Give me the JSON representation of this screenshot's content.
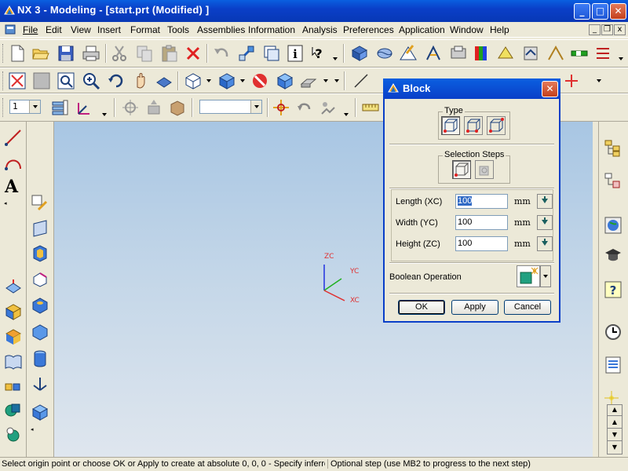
{
  "window": {
    "title": "NX 3 - Modeling - [start.prt (Modified) ]",
    "controls": {
      "minimize": "_",
      "maximize": "□",
      "close": "✕"
    }
  },
  "menubar": {
    "items": [
      {
        "label": "File"
      },
      {
        "label": "Edit"
      },
      {
        "label": "View"
      },
      {
        "label": "Insert"
      },
      {
        "label": "Format"
      },
      {
        "label": "Tools"
      },
      {
        "label": "Assemblies"
      },
      {
        "label": "Information"
      },
      {
        "label": "Analysis"
      },
      {
        "label": "Preferences"
      },
      {
        "label": "Application"
      },
      {
        "label": "Window"
      },
      {
        "label": "Help"
      }
    ],
    "mdi": {
      "minimize": "_",
      "restore": "❐",
      "close": "x"
    }
  },
  "toolbar3": {
    "layer_combo_value": "1",
    "filter_combo_value": ""
  },
  "left_dock": {
    "text_tool_glyph": "A"
  },
  "viewport": {
    "axes": {
      "z_label": "ZC",
      "y_label": "YC",
      "x_label": "XC"
    }
  },
  "dialog": {
    "title": "Block",
    "close_glyph": "✕",
    "type_group_label": "Type",
    "selection_steps_label": "Selection Steps",
    "fields": [
      {
        "label": "Length (XC)",
        "value": "100",
        "unit": "mm"
      },
      {
        "label": "Width (YC)",
        "value": "100",
        "unit": "mm"
      },
      {
        "label": "Height (ZC)",
        "value": "100",
        "unit": "mm"
      }
    ],
    "boolean_label": "Boolean Operation",
    "buttons": {
      "ok": "OK",
      "apply": "Apply",
      "cancel": "Cancel"
    }
  },
  "statusbar": {
    "prompt": "Select origin point or choose OK or Apply to create at absolute 0, 0, 0 - Specify inferre",
    "hint": "Optional step (use MB2 to progress to the next step)"
  },
  "colors": {
    "titlebar": "#0a3fc8",
    "viewport_top": "#a8c6e3",
    "viewport_bottom": "#dfe6ee",
    "axis_x": "#e03030",
    "axis_y": "#20b020",
    "axis_z": "#2030e0"
  }
}
